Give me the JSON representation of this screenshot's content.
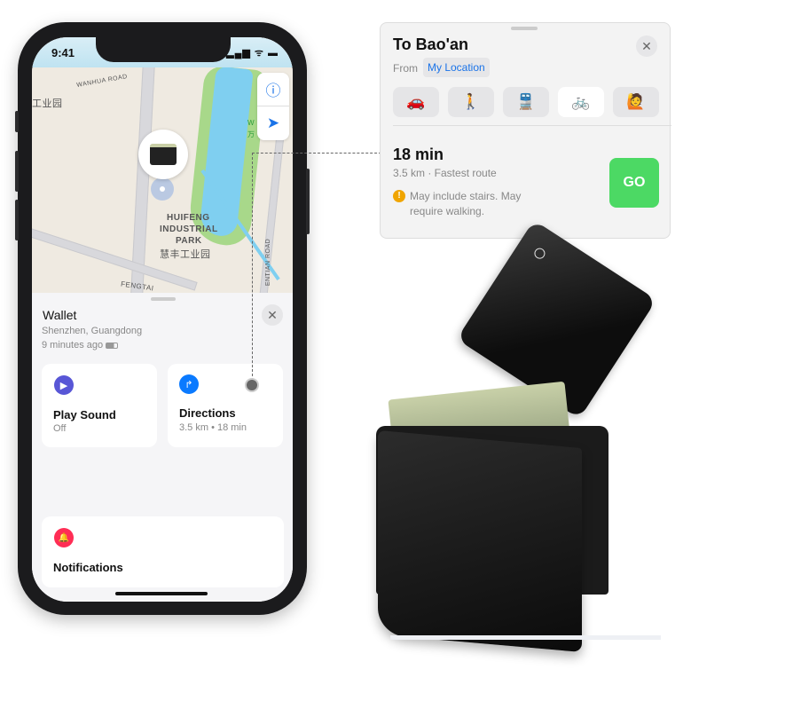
{
  "status_bar": {
    "time": "9:41",
    "signal": "▂▄▆ ᯤ ▬"
  },
  "map": {
    "labels": [
      "WANHUA ROAD",
      "工业园",
      "HUIFENG",
      "INDUSTRIAL",
      "PARK",
      "慧丰工业园",
      "FENGTAI",
      "ENTIAN ROAD",
      "W",
      "万"
    ],
    "buttons": [
      {
        "icon": "info-icon",
        "glyph": "ⓘ"
      },
      {
        "icon": "location-arrow-icon",
        "glyph": "➤"
      }
    ]
  },
  "item_sheet": {
    "title": "Wallet",
    "location": "Shenzhen, Guangdong",
    "updated": "9 minutes ago",
    "close": "✕",
    "actions": [
      {
        "label": "Play Sound",
        "sub": "Off",
        "color": "#5856d6",
        "glyph": "▶"
      },
      {
        "label": "Directions",
        "sub": "3.5 km • 18 min",
        "color": "#0a7aff",
        "glyph": "↱"
      },
      {
        "label": "Notifications",
        "color": "#ff2d55",
        "glyph": "🔔"
      }
    ]
  },
  "directions_card": {
    "title": "To Bao'an",
    "from_label": "From",
    "from_value": "My Location",
    "close": "✕",
    "modes": [
      {
        "name": "drive",
        "glyph": "🚗"
      },
      {
        "name": "walk",
        "glyph": "🚶"
      },
      {
        "name": "transit",
        "glyph": "🚆"
      },
      {
        "name": "cycle",
        "glyph": "🚲",
        "selected": true
      },
      {
        "name": "rideshare",
        "glyph": "🙋"
      }
    ],
    "duration": "18 min",
    "summary": "3.5 km · Fastest route",
    "warning": "May include stairs. May require walking.",
    "go": "GO",
    "colors": {
      "go": "#4cd964",
      "link": "#1a73e8",
      "warning": "#f0a500"
    }
  }
}
